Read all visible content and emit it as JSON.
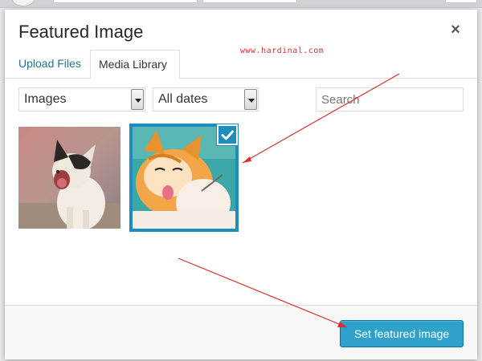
{
  "modal": {
    "title": "Featured Image",
    "close_glyph": "×",
    "close_icon": "close-icon"
  },
  "watermark": "www.hardinal.com",
  "tabs": [
    {
      "label": "Upload Files",
      "active": false
    },
    {
      "label": "Media Library",
      "active": true
    }
  ],
  "filters": {
    "type_selected": "Images",
    "date_selected": "All dates",
    "search_placeholder": "Search"
  },
  "media": [
    {
      "subject": "yawning kitten",
      "selected": false
    },
    {
      "subject": "orange tabby cat licking",
      "selected": true,
      "check_icon": "checkmark-icon"
    }
  ],
  "toolbar": {
    "primary_label": "Set featured image"
  },
  "colors": {
    "accent": "#1e8cbe",
    "button": "#2ea2cc",
    "button_border": "#0074a2",
    "link": "#21759b",
    "annotation": "#d9302e"
  }
}
